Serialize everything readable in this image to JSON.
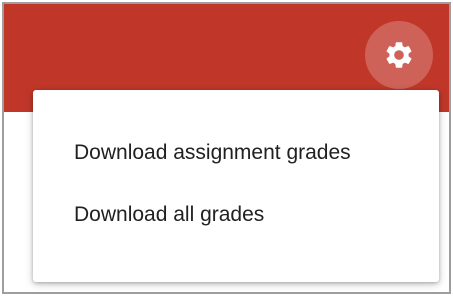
{
  "header": {
    "color": "#c0372a",
    "settings_icon": "gear-icon"
  },
  "menu": {
    "items": [
      {
        "label": "Download assignment grades"
      },
      {
        "label": "Download all grades"
      }
    ]
  }
}
